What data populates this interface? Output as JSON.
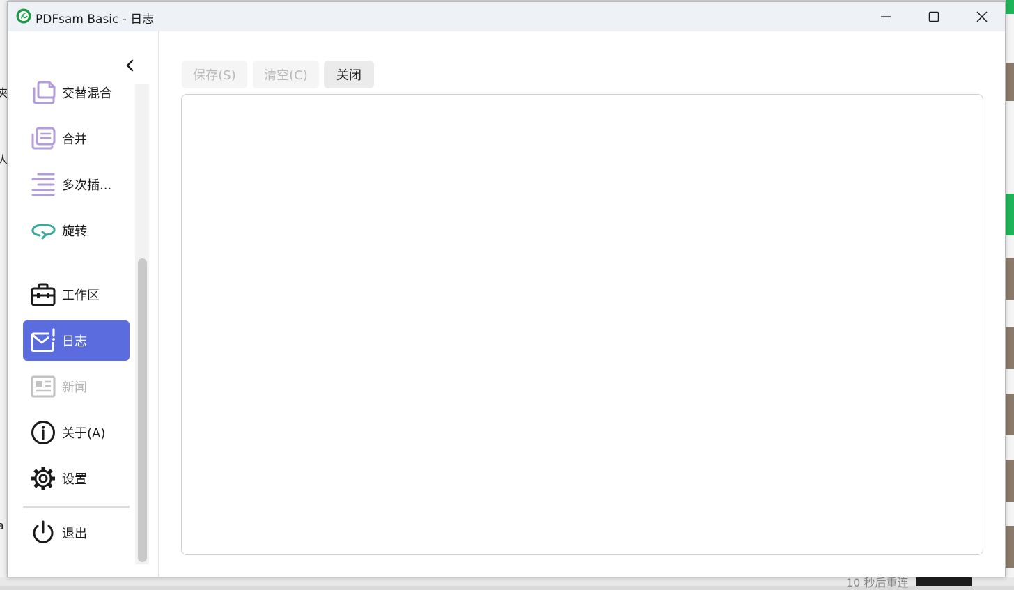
{
  "window": {
    "title": "PDFsam Basic - 日志",
    "controls": {
      "minimize": "minimize-icon",
      "maximize": "maximize-icon",
      "close": "close-icon"
    }
  },
  "sidebar": {
    "items": [
      {
        "label": "交替混合",
        "icon": "alternate-mix-icon",
        "state": "normal"
      },
      {
        "label": "合并",
        "icon": "merge-icon",
        "state": "normal"
      },
      {
        "label": "多次插...",
        "icon": "multiple-insert-icon",
        "state": "normal"
      },
      {
        "label": "旋转",
        "icon": "rotate-icon",
        "state": "normal"
      },
      {
        "label": "工作区",
        "icon": "briefcase-icon",
        "state": "normal"
      },
      {
        "label": "日志",
        "icon": "log-icon",
        "state": "active"
      },
      {
        "label": "新闻",
        "icon": "news-icon",
        "state": "disabled"
      },
      {
        "label": "关于(A)",
        "icon": "info-icon",
        "state": "normal"
      },
      {
        "label": "设置",
        "icon": "gear-icon",
        "state": "normal"
      },
      {
        "label": "退出",
        "icon": "power-icon",
        "state": "normal"
      }
    ]
  },
  "toolbar": {
    "save_label": "保存(S)",
    "clear_label": "清空(C)",
    "close_label": "关闭"
  },
  "log": {
    "content": ""
  },
  "background": {
    "left_fragments": [
      "夹",
      "人",
      "a"
    ],
    "bottom_fragment": "10 秒后重连"
  },
  "colors": {
    "accent": "#5a6cde",
    "icon_purple": "#b39ddb",
    "icon_teal": "#3aa89a",
    "titlebar": "#eef1f6",
    "disabled_text": "#b4b4b4"
  }
}
